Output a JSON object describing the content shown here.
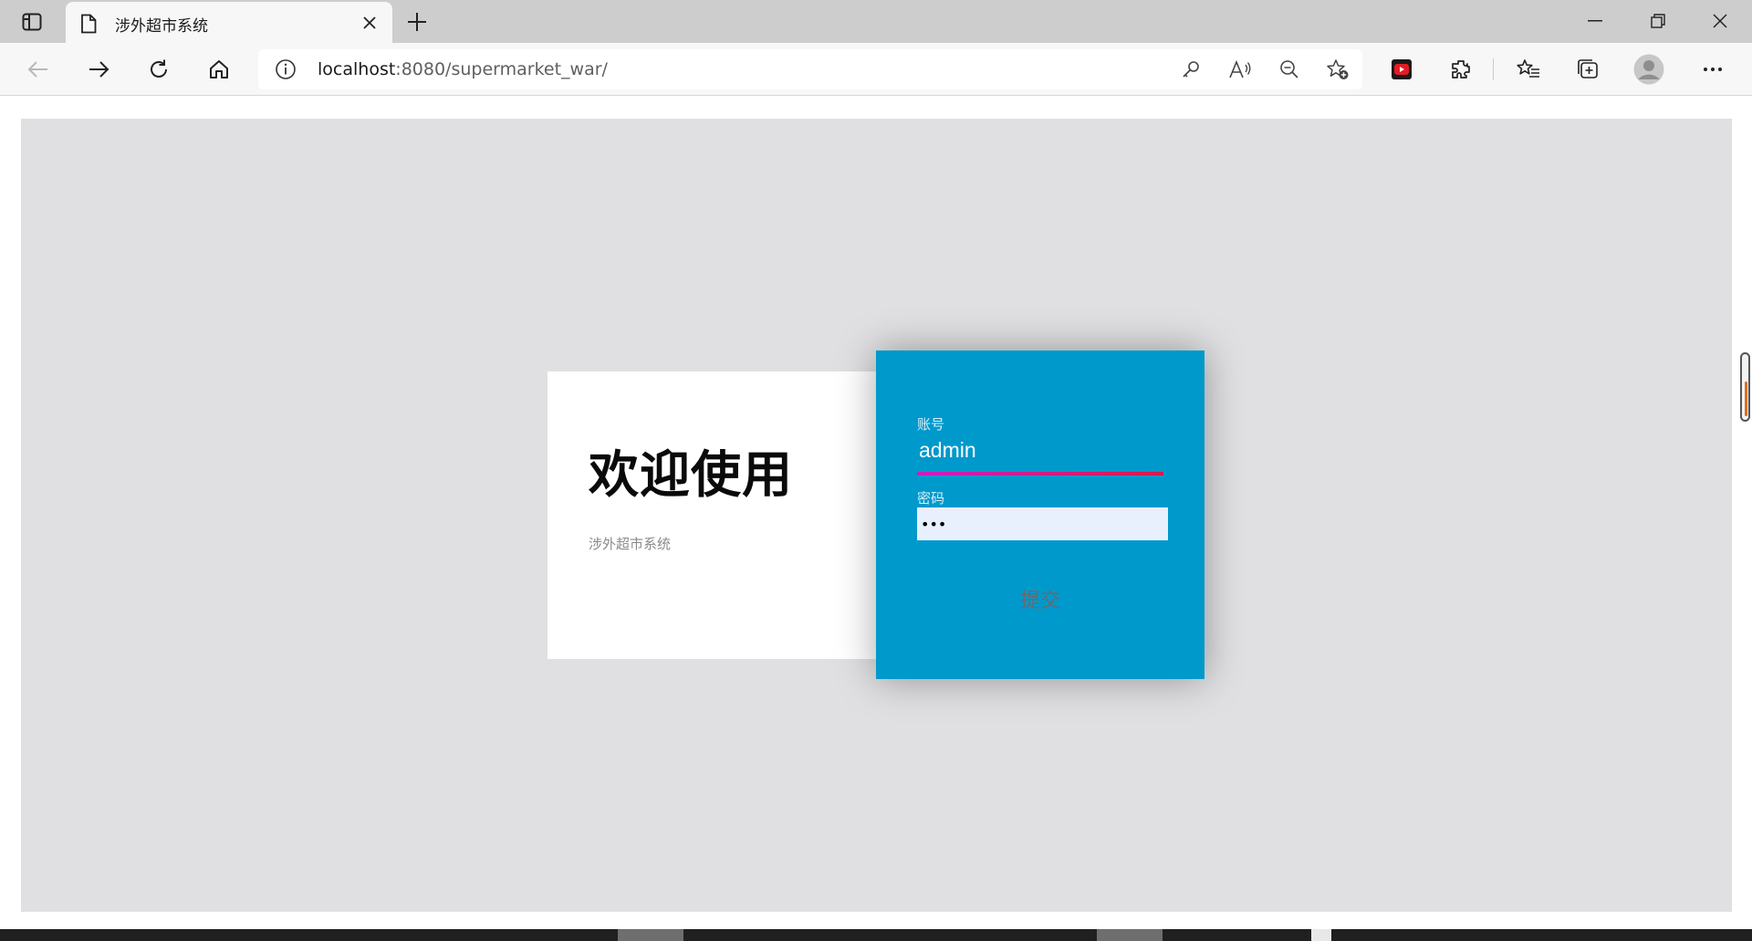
{
  "browser": {
    "tab_title": "涉外超市系统",
    "url_host": "localhost",
    "url_path": ":8080/supermarket_war/"
  },
  "page": {
    "welcome_title": "欢迎使用",
    "welcome_subtitle": "涉外超市系统",
    "login": {
      "account_label": "账号",
      "account_value": "admin",
      "password_label": "密码",
      "password_value": "•••",
      "submit_label": "提交"
    }
  },
  "colors": {
    "login_panel": "#0099cc",
    "page_background": "#e0e0e2",
    "focus_underline": "#c81ec8"
  },
  "icons": [
    "sidebar-tabs-icon",
    "document-icon",
    "close-icon",
    "new-tab-icon",
    "minimize-icon",
    "restore-icon",
    "window-close-icon",
    "back-icon",
    "forward-icon",
    "refresh-icon",
    "home-icon",
    "info-icon",
    "key-icon",
    "read-aloud-icon",
    "zoom-out-icon",
    "add-favorite-icon",
    "youtube-extension-icon",
    "extensions-icon",
    "favorites-icon",
    "collections-icon",
    "profile-icon",
    "more-icon"
  ]
}
